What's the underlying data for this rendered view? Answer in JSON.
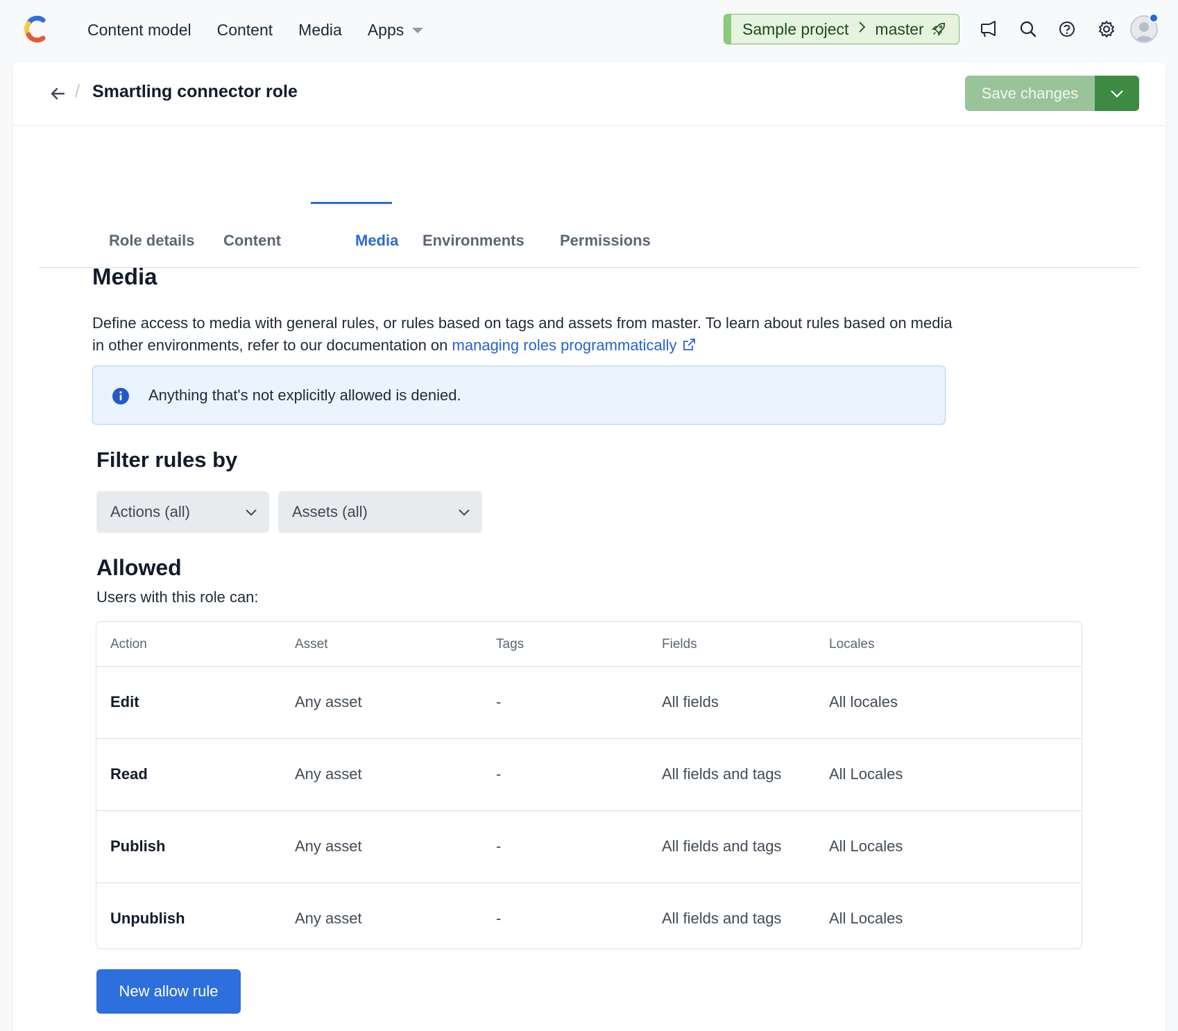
{
  "topnav": {
    "links": [
      {
        "label": "Content model"
      },
      {
        "label": "Content"
      },
      {
        "label": "Media"
      },
      {
        "label": "Apps"
      }
    ],
    "environment": {
      "space": "Sample project",
      "env": "master"
    }
  },
  "header": {
    "title": "Smartling connector role",
    "save_label": "Save changes"
  },
  "tabs": [
    {
      "label": "Role details"
    },
    {
      "label": "Content"
    },
    {
      "label": "Media"
    },
    {
      "label": "Environments"
    },
    {
      "label": "Permissions"
    }
  ],
  "main": {
    "heading": "Media",
    "description": "Define access to media with general rules, or rules based on tags and assets from master. To learn about rules based on media in other environments, refer to our documentation on",
    "doc_link": "managing roles programmatically",
    "info_note": "Anything that's not explicitly allowed is denied.",
    "filter_heading": "Filter rules by",
    "filters": {
      "actions": "Actions (all)",
      "assets": "Assets (all)"
    },
    "allowed_heading": "Allowed",
    "allowed_sub": "Users with this role can:",
    "new_rule_label": "New allow rule"
  },
  "table": {
    "columns": [
      "Action",
      "Asset",
      "Tags",
      "Fields",
      "Locales"
    ],
    "rows": [
      {
        "action": "Edit",
        "asset": "Any asset",
        "tags": "-",
        "fields": "All fields",
        "locales": "All locales"
      },
      {
        "action": "Read",
        "asset": "Any asset",
        "tags": "-",
        "fields": "All fields and tags",
        "locales": "All Locales"
      },
      {
        "action": "Publish",
        "asset": "Any asset",
        "tags": "-",
        "fields": "All fields and tags",
        "locales": "All Locales"
      },
      {
        "action": "Unpublish",
        "asset": "Any asset",
        "tags": "-",
        "fields": "All fields and tags",
        "locales": "All Locales"
      }
    ]
  },
  "colors": {
    "accent": "#2b6ad6",
    "save_disabled": "#99c49a",
    "save_dropdown": "#3d8a43",
    "env_badge_bg": "#e6f3e1",
    "info_bg": "#eaf4fe"
  },
  "icons": [
    "contentful-logo",
    "caret-down-icon",
    "chevron-right-icon",
    "rocket-icon",
    "megaphone-icon",
    "search-icon",
    "help-icon",
    "gear-icon",
    "avatar",
    "back-arrow-icon",
    "chevron-down-icon",
    "info-icon",
    "external-link-icon"
  ]
}
